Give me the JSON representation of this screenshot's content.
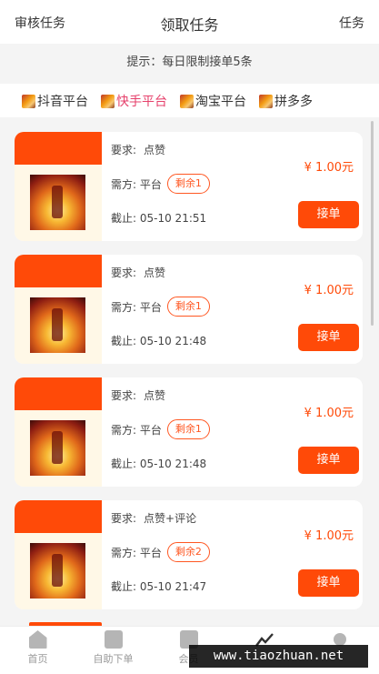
{
  "topbar": {
    "left": "审核任务",
    "title": "领取任务",
    "right": "任务"
  },
  "notice": "提示：每日限制接单5条",
  "platforms": [
    {
      "label": "抖音平台",
      "active": false
    },
    {
      "label": "快手平台",
      "active": true
    },
    {
      "label": "淘宝平台",
      "active": false
    },
    {
      "label": "拼多多",
      "active": false
    }
  ],
  "labels": {
    "require": "要求:",
    "from": "需方: 平台",
    "deadline_prefix": "截止:"
  },
  "tasks": [
    {
      "requirement": "点赞",
      "remaining": "剩余1",
      "deadline": "05-10 21:51",
      "price": "¥ 1.00元",
      "button": "接单"
    },
    {
      "requirement": "点赞",
      "remaining": "剩余1",
      "deadline": "05-10 21:48",
      "price": "¥ 1.00元",
      "button": "接单"
    },
    {
      "requirement": "点赞",
      "remaining": "剩余1",
      "deadline": "05-10 21:48",
      "price": "¥ 1.00元",
      "button": "接单"
    },
    {
      "requirement": "点赞+评论",
      "remaining": "剩余2",
      "deadline": "05-10 21:47",
      "price": "¥ 1.00元",
      "button": "接单"
    }
  ],
  "tabbar": [
    {
      "label": "首页",
      "icon": "home-icon"
    },
    {
      "label": "自助下单",
      "icon": "order-icon"
    },
    {
      "label": "会员",
      "icon": "member-icon"
    },
    {
      "label": "",
      "icon": "chart-icon"
    },
    {
      "label": "",
      "icon": "user-icon"
    }
  ],
  "watermark": "www.tiaozhuan.net"
}
